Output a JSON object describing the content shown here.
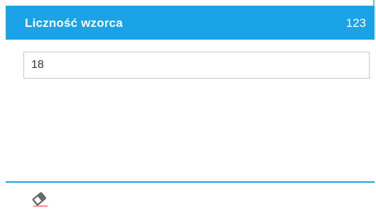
{
  "header": {
    "title": "Liczność wzorca",
    "mode": "123"
  },
  "field": {
    "value": "18"
  },
  "toolbar": {
    "clear_icon": "eraser-icon"
  },
  "colors": {
    "accent": "#1aa3e6",
    "border": "#c6c6c6",
    "text": "#333333"
  }
}
